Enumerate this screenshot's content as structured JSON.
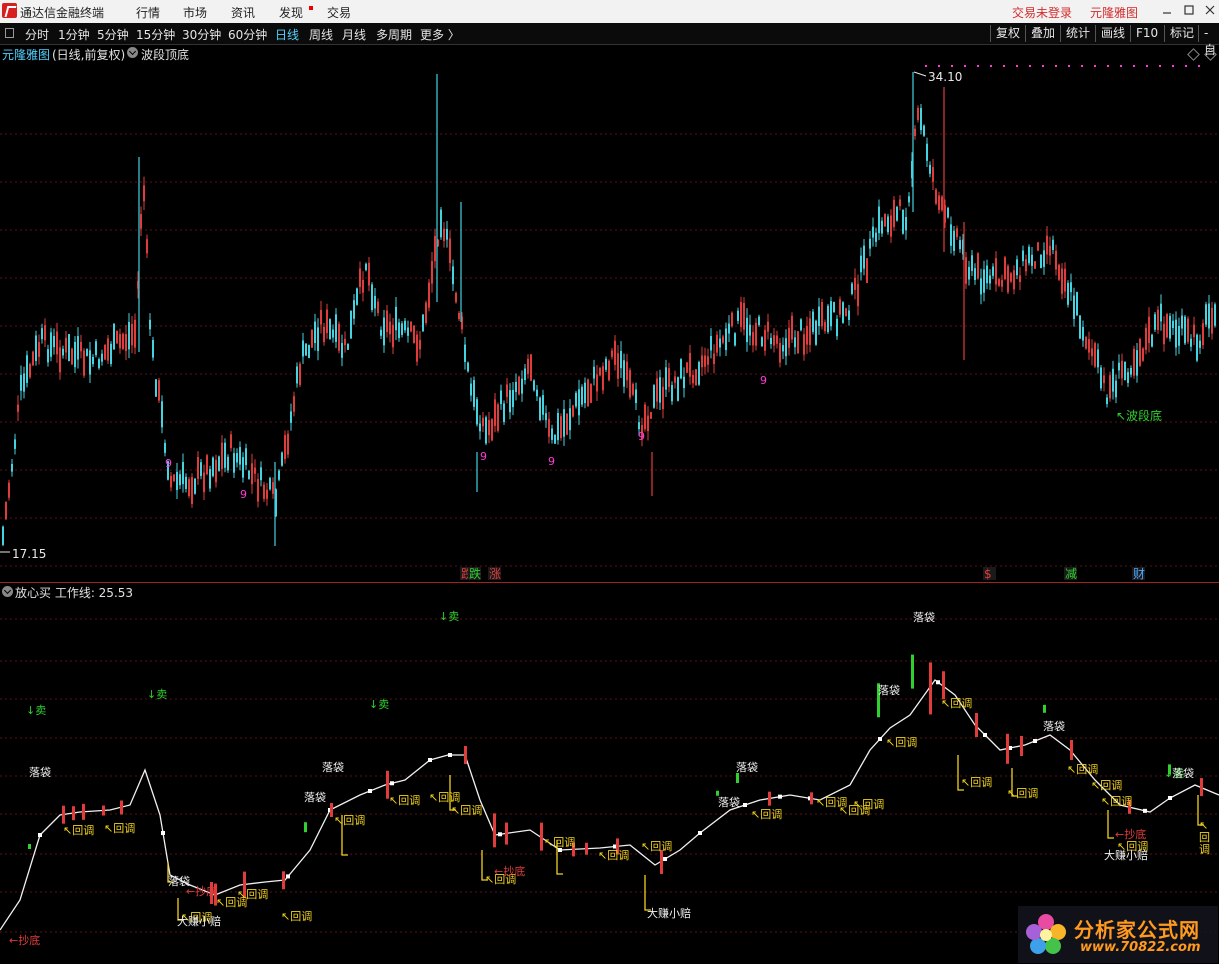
{
  "menubar": {
    "app_title": "通达信金融终端",
    "items": [
      "行情",
      "市场",
      "资讯",
      "发现",
      "交易"
    ],
    "login_status": "交易未登录",
    "indicator_name": "元隆雅图"
  },
  "toolbar": {
    "periods": [
      "分时",
      "1分钟",
      "5分钟",
      "15分钟",
      "30分钟",
      "60分钟",
      "日线",
      "周线",
      "月线",
      "多周期",
      "更多 〉"
    ],
    "active_period": "日线",
    "right_buttons": [
      "复权",
      "叠加",
      "统计",
      "画线",
      "F10",
      "标记",
      "-自"
    ]
  },
  "main_panel": {
    "stock_name": "元隆雅图",
    "period_info": "(日线,前复权)",
    "indicator": "波段顶底",
    "high_label": "34.10",
    "low_label": "17.15",
    "wave_bottom_label": "波段底",
    "nine_marker": "9",
    "event_markers": [
      "跌",
      "涨",
      "$",
      "减",
      "财"
    ]
  },
  "sub_panel": {
    "title": "放心买  工作线: 25.53",
    "labels": {
      "sell": "↓卖",
      "pocket": "落袋",
      "pullback": "回调",
      "bottom_fish": "←抄底",
      "big_win": "大赚小赔"
    }
  },
  "watermark": {
    "brand": "分析家公式网",
    "url": "www.70822.com"
  },
  "colors": {
    "up": "#e03c3c",
    "down": "#44d3e0",
    "accent_cyan": "#4fd2ff",
    "sell_green": "#2fd02f",
    "yellow": "#f2d21f",
    "magenta": "#ff3bd6"
  }
}
